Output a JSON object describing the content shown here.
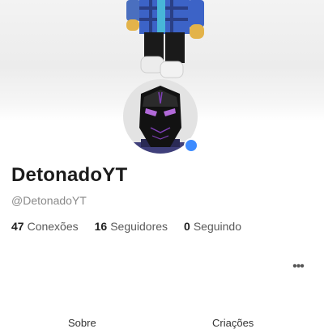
{
  "profile": {
    "display_name": "DetonadoYT",
    "username": "@DetonadoYT",
    "online_status_color": "#3d8bff"
  },
  "stats": [
    {
      "count": "47",
      "label": "Conexões"
    },
    {
      "count": "16",
      "label": "Seguidores"
    },
    {
      "count": "0",
      "label": "Seguindo"
    }
  ],
  "actions": {
    "more_icon": "more-horizontal-icon",
    "more_label": "•••"
  },
  "tabs": [
    {
      "label": "Sobre"
    },
    {
      "label": "Criações"
    }
  ]
}
